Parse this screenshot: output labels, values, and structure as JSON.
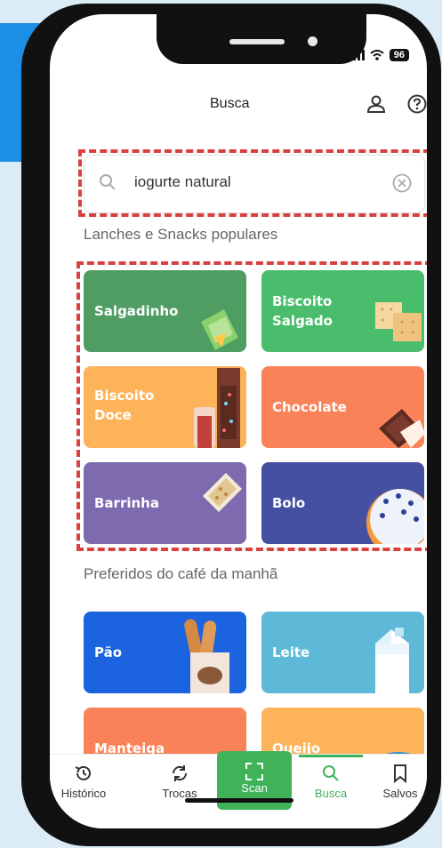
{
  "status": {
    "battery": "96"
  },
  "header": {
    "title": "Busca"
  },
  "search": {
    "value": "iogurte natural"
  },
  "sections": [
    {
      "title": "Lanches e Snacks populares"
    },
    {
      "title": "Preferidos do café da manhã"
    }
  ],
  "snacks": [
    {
      "label": "Salgadinho",
      "color": "#4f9d63"
    },
    {
      "label": "Biscoito Salgado",
      "color": "#49bd6c"
    },
    {
      "label": "Biscoito Doce",
      "color": "#fdb35a"
    },
    {
      "label": "Chocolate",
      "color": "#f98258"
    },
    {
      "label": "Barrinha",
      "color": "#7e6aaf"
    },
    {
      "label": "Bolo",
      "color": "#4550a1"
    }
  ],
  "breakfast": [
    {
      "label": "Pão",
      "color": "#1c63df"
    },
    {
      "label": "Leite",
      "color": "#5eb9d8"
    },
    {
      "label": "Manteiga",
      "color": "#f98258"
    },
    {
      "label": "Queijo",
      "color": "#fdb35a"
    }
  ],
  "tabs": [
    {
      "label": "Histórico",
      "icon": "history-icon"
    },
    {
      "label": "Trocas",
      "icon": "swap-icon"
    },
    {
      "label": "Scan",
      "icon": "scan-icon"
    },
    {
      "label": "Busca",
      "icon": "search-icon"
    },
    {
      "label": "Salvos",
      "icon": "bookmark-icon"
    }
  ],
  "colors": {
    "accent": "#3fb25a",
    "highlight": "#d9403f"
  }
}
